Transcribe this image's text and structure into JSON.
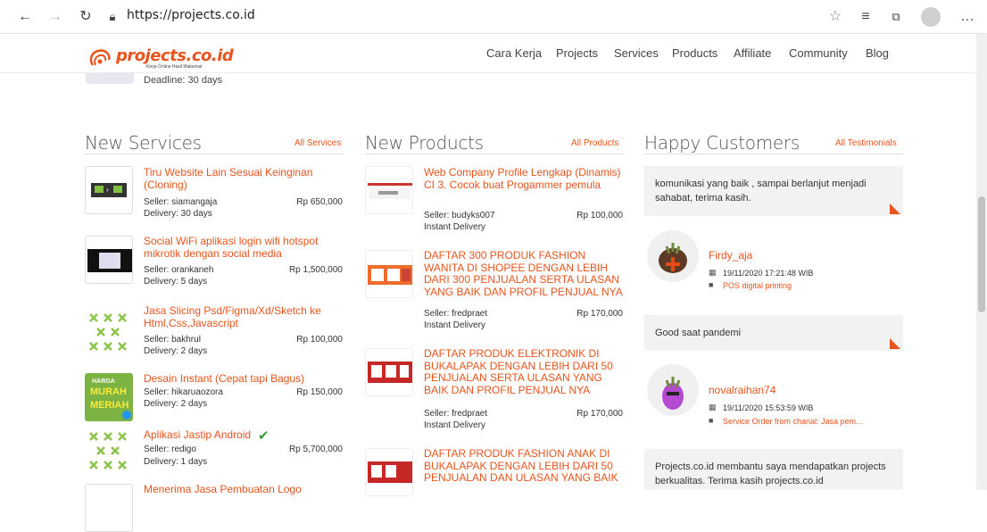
{
  "browser": {
    "url": "https://projects.co.id"
  },
  "site": {
    "logo_text": "projects.co.id",
    "logo_sub": "Kerja Online Hasil Maksimal",
    "nav": [
      "Cara Kerja",
      "Projects",
      "Services",
      "Products",
      "Affiliate",
      "Community",
      "Blog"
    ]
  },
  "prev": {
    "deadline": "Deadline: 30 days"
  },
  "services": {
    "title": "New Services",
    "link": "All Services",
    "items": [
      {
        "title": "Tiru Website Lain Sesuai Keinginan (Cloning)",
        "seller": "Seller: siamangaja",
        "price": "Rp 650,000",
        "delivery": "Delivery: 30 days"
      },
      {
        "title": "Social WiFi aplikasi login wifi hotspot mikrotik dengan social media",
        "seller": "Seller: orankaneh",
        "price": "Rp 1,500,000",
        "delivery": "Delivery: 5 days"
      },
      {
        "title": "Jasa Slicing Psd/Figma/Xd/Sketch ke Html,Css,Javascript",
        "seller": "Seller: bakhrul",
        "price": "Rp 100,000",
        "delivery": "Delivery: 2 days"
      },
      {
        "title": "Desain Instant (Cepat tapi Bagus)",
        "seller": "Seller: hikaruaozora",
        "price": "Rp 150,000",
        "delivery": "Delivery: 2 days"
      },
      {
        "title": "Aplikasi Jastip Android",
        "seller": "Seller: redigo",
        "price": "Rp 5,700,000",
        "delivery": "Delivery: 1 days"
      },
      {
        "title": "Menerima Jasa Pembuatan Logo"
      }
    ]
  },
  "products": {
    "title": "New Products",
    "link": "All Products",
    "items": [
      {
        "title": "Web Company Profile Lengkap (Dinamis) CI 3. Cocok buat Progammer pemula",
        "seller": "Seller: budyks007",
        "price": "Rp 100,000",
        "delivery": "Instant Delivery"
      },
      {
        "title": "DAFTAR 300 PRODUK FASHION WANITA DI SHOPEE DENGAN LEBIH DARI 300 PENJUALAN SERTA ULASAN YANG BAIK DAN PROFIL PENJUAL NYA",
        "seller": "Seller: fredpraet",
        "price": "Rp 170,000",
        "delivery": "Instant Delivery"
      },
      {
        "title": "DAFTAR PRODUK ELEKTRONIK DI BUKALAPAK DENGAN LEBIH DARI 50 PENJUALAN SERTA ULASAN YANG BAIK DAN PROFIL PENJUAL NYA",
        "seller": "Seller: fredpraet",
        "price": "Rp 170,000",
        "delivery": "Instant Delivery"
      },
      {
        "title": "DAFTAR PRODUK FASHION ANAK DI BUKALAPAK DENGAN LEBIH DARI 50 PENJUALAN DAN ULASAN YANG BAIK"
      }
    ]
  },
  "customers": {
    "title": "Happy Customers",
    "link": "All Testimonials",
    "items": [
      {
        "text": "komunikasi yang baik , sampai berlanjut menjadi sahabat, terima kasih.",
        "name": "Firdy_aja",
        "date": "19/11/2020 17:21:48 WIB",
        "service": "POS digital printing"
      },
      {
        "text": "Good saat pandemi",
        "name": "novalraihan74",
        "date": "19/11/2020 15:53:59 WIB",
        "service": "Service Order from chanal: Jasa pem..."
      },
      {
        "text": "Projects.co.id membantu saya mendapatkan projects berkualitas. Terima kasih projects.co.id"
      }
    ]
  },
  "colors": {
    "accent": "#e8541d"
  }
}
